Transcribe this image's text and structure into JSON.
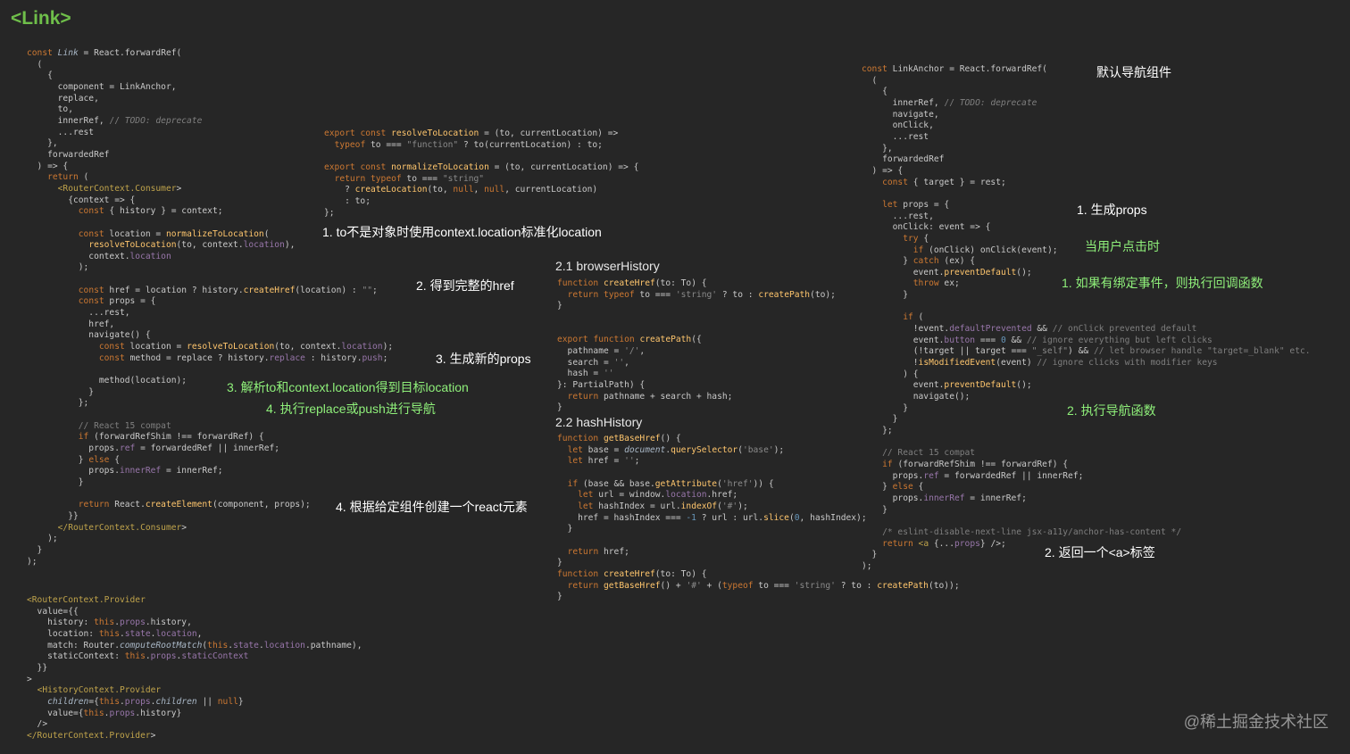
{
  "title": "<Link>",
  "watermark": "@稀土掘金技术社区",
  "section_headings": {
    "browser_history": "2.1 browserHistory",
    "hash_history": "2.2 hashHistory"
  },
  "notes": {
    "link_step1": "1. to不是对象时使用context.location标准化location",
    "link_step2": "2. 得到完整的href",
    "link_step3": "3. 生成新的props",
    "link_step3_sub": "3. 解析to和context.location得到目标location",
    "link_step4_sub": "4. 执行replace或push进行导航",
    "link_step4": "4. 根据给定组件创建一个react元素",
    "anchor_title": "默认导航组件",
    "anchor_step1": "1. 生成props",
    "anchor_click": "当用户点击时",
    "anchor_click_1": "1. 如果有绑定事件，则执行回调函数",
    "anchor_click_2": "2. 执行导航函数",
    "anchor_step2": "2. 返回一个<a>标签"
  },
  "code": {
    "link_component": [
      "const Link = React.forwardRef(",
      "  (",
      "    {",
      "      component = LinkAnchor,",
      "      replace,",
      "      to,",
      "      innerRef, // TODO: deprecate",
      "      ...rest",
      "    },",
      "    forwardedRef",
      "  ) => {",
      "    return (",
      "      <RouterContext.Consumer>",
      "        {context => {",
      "          const { history } = context;",
      "",
      "          const location = normalizeToLocation(",
      "            resolveToLocation(to, context.location),",
      "            context.location",
      "          );",
      "",
      "          const href = location ? history.createHref(location) : \"\";",
      "          const props = {",
      "            ...rest,",
      "            href,",
      "            navigate() {",
      "              const location = resolveToLocation(to, context.location);",
      "              const method = replace ? history.replace : history.push;",
      "",
      "              method(location);",
      "            }",
      "          };",
      "",
      "          // React 15 compat",
      "          if (forwardRefShim !== forwardRef) {",
      "            props.ref = forwardedRef || innerRef;",
      "          } else {",
      "            props.innerRef = innerRef;",
      "          }",
      "",
      "          return React.createElement(component, props);",
      "        }}",
      "      </RouterContext.Consumer>",
      "    );",
      "  }",
      ");"
    ],
    "router_provider": [
      "<RouterContext.Provider",
      "  value={{",
      "    history: this.props.history,",
      "    location: this.state.location,",
      "    match: Router.computeRootMatch(this.state.location.pathname),",
      "    staticContext: this.props.staticContext",
      "  }}",
      ">",
      "  <HistoryContext.Provider",
      "    children={this.props.children || null}",
      "    value={this.props.history}",
      "  />",
      "</RouterContext.Provider>"
    ],
    "location_utils": [
      "export const resolveToLocation = (to, currentLocation) =>",
      "  typeof to === \"function\" ? to(currentLocation) : to;",
      "",
      "export const normalizeToLocation = (to, currentLocation) => {",
      "  return typeof to === \"string\"",
      "    ? createLocation(to, null, null, currentLocation)",
      "    : to;",
      "};"
    ],
    "browser_history": [
      "function createHref(to: To) {",
      "  return typeof to === 'string' ? to : createPath(to);",
      "}",
      "",
      "",
      "export function createPath({",
      "  pathname = '/',",
      "  search = '',",
      "  hash = ''",
      "}: PartialPath) {",
      "  return pathname + search + hash;",
      "}"
    ],
    "hash_history": [
      "function getBaseHref() {",
      "  let base = document.querySelector('base');",
      "  let href = '';",
      "",
      "  if (base && base.getAttribute('href')) {",
      "    let url = window.location.href;",
      "    let hashIndex = url.indexOf('#');",
      "    href = hashIndex === -1 ? url : url.slice(0, hashIndex);",
      "  }",
      "",
      "  return href;",
      "}",
      "function createHref(to: To) {",
      "  return getBaseHref() + '#' + (typeof to === 'string' ? to : createPath(to));",
      "}"
    ],
    "link_anchor": [
      "const LinkAnchor = React.forwardRef(",
      "  (",
      "    {",
      "      innerRef, // TODO: deprecate",
      "      navigate,",
      "      onClick,",
      "      ...rest",
      "    },",
      "    forwardedRef",
      "  ) => {",
      "    const { target } = rest;",
      "",
      "    let props = {",
      "      ...rest,",
      "      onClick: event => {",
      "        try {",
      "          if (onClick) onClick(event);",
      "        } catch (ex) {",
      "          event.preventDefault();",
      "          throw ex;",
      "        }",
      "",
      "        if (",
      "          !event.defaultPrevented && // onClick prevented default",
      "          event.button === 0 && // ignore everything but left clicks",
      "          (!target || target === \"_self\") && // let browser handle \"target=_blank\" etc.",
      "          !isModifiedEvent(event) // ignore clicks with modifier keys",
      "        ) {",
      "          event.preventDefault();",
      "          navigate();",
      "        }",
      "      }",
      "    };",
      "",
      "    // React 15 compat",
      "    if (forwardRefShim !== forwardRef) {",
      "      props.ref = forwardedRef || innerRef;",
      "    } else {",
      "      props.innerRef = innerRef;",
      "    }",
      "",
      "    /* eslint-disable-next-line jsx-a11y/anchor-has-content */",
      "    return <a {...props} />;",
      "  }",
      ");"
    ]
  }
}
